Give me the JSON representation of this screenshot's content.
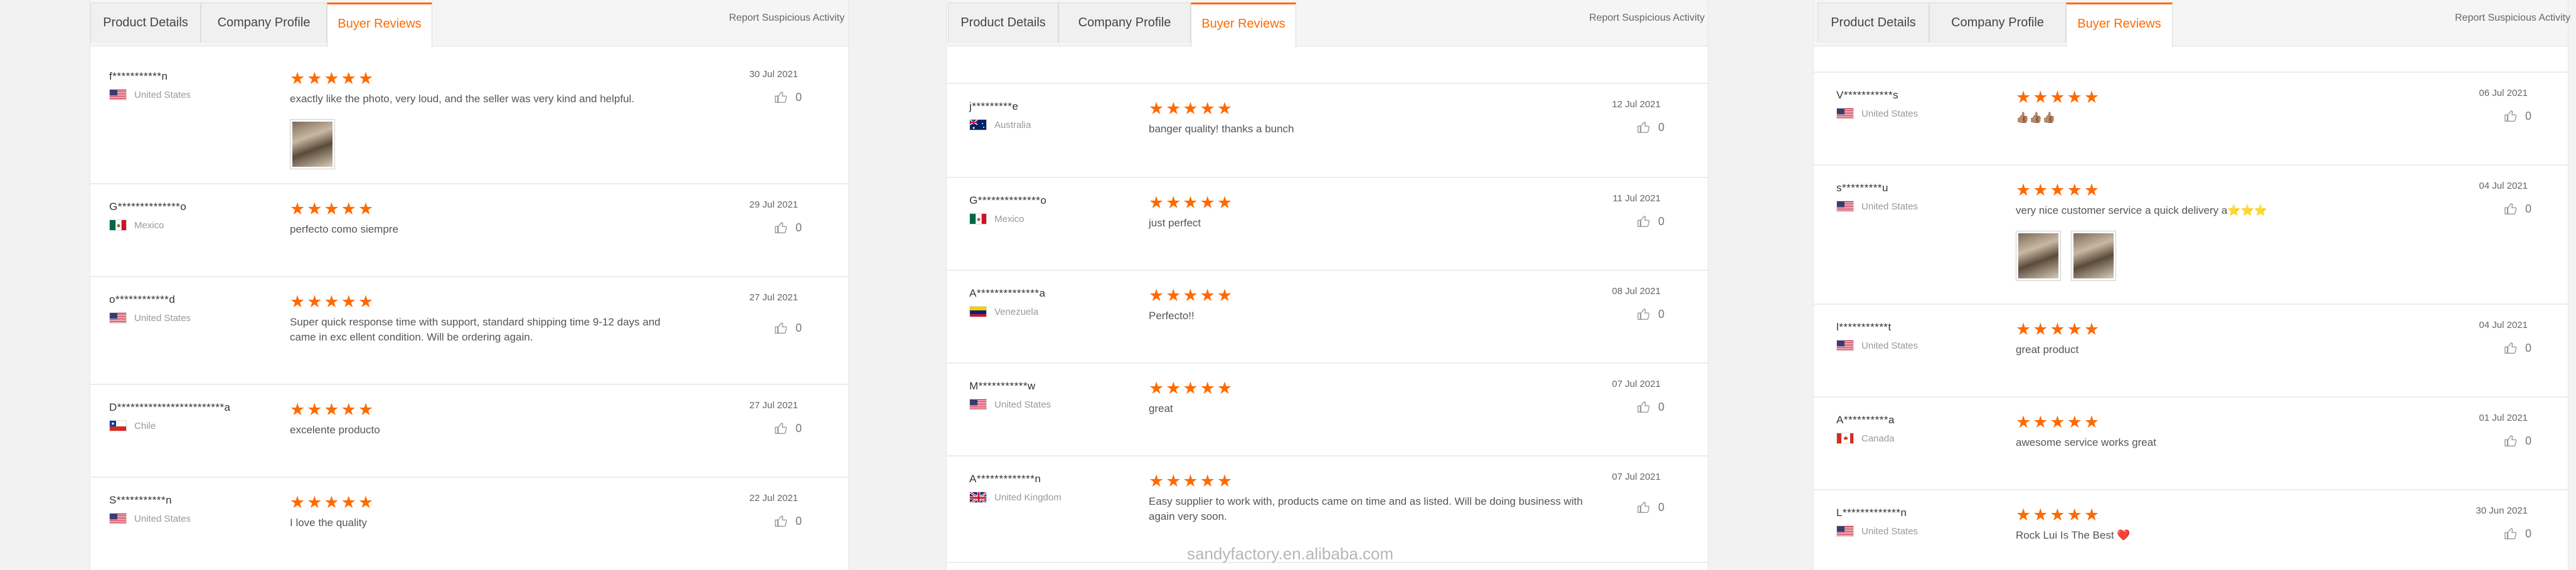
{
  "tabs": {
    "product_details": "Product Details",
    "company_profile": "Company Profile",
    "buyer_reviews": "Buyer Reviews"
  },
  "report_label": "Report Suspicious Activity",
  "stars": "★★★★★",
  "accent_color": "#ff6a00",
  "panels": [
    {
      "reviews": [
        {
          "name": "f***********n",
          "country": "United States",
          "flag": "us",
          "comment": "exactly like the photo, very loud, and the seller was very kind and helpful.",
          "date": "30 Jul 2021",
          "likes": "0",
          "photos": 1
        },
        {
          "name": "G**************o",
          "country": "Mexico",
          "flag": "mx",
          "comment": "perfecto como siempre",
          "date": "29 Jul 2021",
          "likes": "0",
          "photos": 0
        },
        {
          "name": "o************d",
          "country": "United States",
          "flag": "us",
          "comment": "Super quick response time with support, standard shipping time 9-12 days and came in exc ellent condition. Will be ordering again.",
          "date": "27 Jul 2021",
          "likes": "0",
          "photos": 0
        },
        {
          "name": "D************************a",
          "country": "Chile",
          "flag": "cl",
          "comment": "excelente producto",
          "date": "27 Jul 2021",
          "likes": "0",
          "photos": 0
        },
        {
          "name": "S***********n",
          "country": "United States",
          "flag": "us",
          "comment": "I love the quality",
          "date": "22 Jul 2021",
          "likes": "0",
          "photos": 0
        }
      ]
    },
    {
      "reviews": [
        {
          "name": "j*********e",
          "country": "Australia",
          "flag": "au",
          "comment": "banger quality! thanks a bunch",
          "date": "12 Jul 2021",
          "likes": "0",
          "photos": 0
        },
        {
          "name": "G**************o",
          "country": "Mexico",
          "flag": "mx",
          "comment": "just perfect",
          "date": "11 Jul 2021",
          "likes": "0",
          "photos": 0
        },
        {
          "name": "A**************a",
          "country": "Venezuela",
          "flag": "ve",
          "comment": "Perfecto!!",
          "date": "08 Jul 2021",
          "likes": "0",
          "photos": 0
        },
        {
          "name": "M***********w",
          "country": "United States",
          "flag": "us",
          "comment": "great",
          "date": "07 Jul 2021",
          "likes": "0",
          "photos": 0
        },
        {
          "name": "A*************n",
          "country": "United Kingdom",
          "flag": "gb",
          "comment": "Easy supplier to work with, products came on time and as listed. Will be doing business with again very soon.",
          "date": "07 Jul 2021",
          "likes": "0",
          "photos": 0
        }
      ]
    },
    {
      "reviews": [
        {
          "name": "V***********s",
          "country": "United States",
          "flag": "us",
          "comment": "👍🏽👍🏽👍🏽",
          "date": "06 Jul 2021",
          "likes": "0",
          "photos": 0
        },
        {
          "name": "s*********u",
          "country": "United States",
          "flag": "us",
          "comment": "very nice customer service a quick delivery a⭐⭐⭐",
          "date": "04 Jul 2021",
          "likes": "0",
          "photos": 2
        },
        {
          "name": "l***********t",
          "country": "United States",
          "flag": "us",
          "comment": "great product",
          "date": "04 Jul 2021",
          "likes": "0",
          "photos": 0
        },
        {
          "name": "A**********a",
          "country": "Canada",
          "flag": "ca",
          "comment": "awesome service works great",
          "date": "01 Jul 2021",
          "likes": "0",
          "photos": 0
        },
        {
          "name": "L*************n",
          "country": "United States",
          "flag": "us",
          "comment": "Rock Lui Is The Best ❤️",
          "date": "30 Jun 2021",
          "likes": "0",
          "photos": 0
        }
      ]
    }
  ],
  "watermark": "sandyfactory.en.alibaba.com"
}
